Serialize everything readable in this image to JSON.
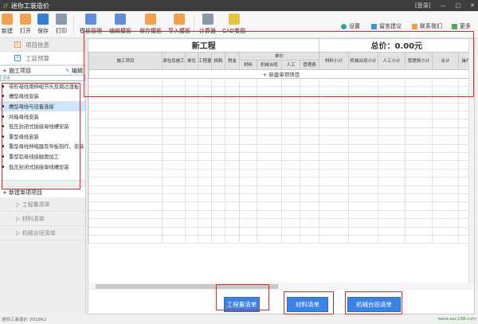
{
  "app": {
    "title": "迷你工装造价",
    "login": "[登录]"
  },
  "toolbar": {
    "new": "新建",
    "open": "打开",
    "save": "保存",
    "print": "打印",
    "template_manage": "模板管理",
    "edit_template": "编辑模板",
    "save_template": "保存模板",
    "import_template": "导入模板",
    "calculator": "计算器",
    "cad": "CAD看图"
  },
  "topright": {
    "settings": "设置",
    "feedback": "留言建议",
    "contact": "联系我们",
    "more": "更多"
  },
  "sidebar": {
    "nav": [
      "项目信息",
      "工装预算"
    ],
    "section": "施工项目",
    "edit": "编辑",
    "search_placeholder": "搜索",
    "items": [
      "带形母线用伸缩节头及铜过渡板",
      "槽型母线安装",
      "槽型母线与设备连接",
      "共箱母线安装",
      "低压封闭式插接母线槽安装",
      "重型母线安装",
      "重型母线伸缩器及导板制作、安装",
      "重型铝母线接触面加工",
      "低压封闭式插接母线槽安装"
    ],
    "new_item": "新建单项项目",
    "subs": [
      "工程量清单",
      "材料清单",
      "机械台班清单"
    ]
  },
  "table": {
    "project_title": "新工程",
    "total": "总价：0.00元",
    "headers": {
      "item": "施工项目",
      "spec": "承包及施工",
      "unit": "单位",
      "qty": "工程量",
      "loss": "损耗",
      "tax": "税金",
      "unit_price": "单价",
      "material": "材料",
      "machine": "机械台班",
      "labor": "人工",
      "mgmt": "管理费",
      "material_sub": "材料小计",
      "machine_sub": "机械台班小计",
      "labor_sub": "人工小计",
      "mgmt_sub": "管理费小计",
      "total": "合计",
      "ops": "操作"
    },
    "new_row": "+ 新建单项项目"
  },
  "buttons": {
    "qty_list": "工程量清单",
    "material_list": "材料清单",
    "machine_list": "机械台班清单"
  },
  "status": {
    "left": "迷你工装造价 2018R2",
    "right": "www.aec188.com"
  },
  "colors": {
    "accent": "#3b82e8",
    "annotation": "#e8242a",
    "titlebar": "#3d3d3d"
  }
}
